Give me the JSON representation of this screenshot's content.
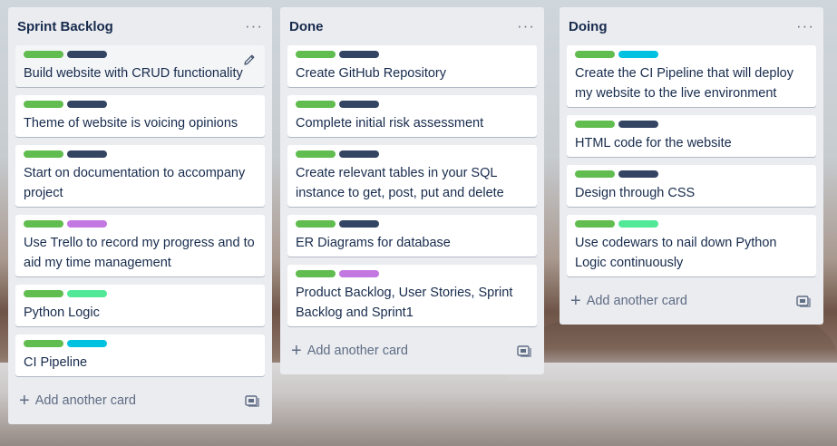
{
  "colors": {
    "green": "#61bd4f",
    "navy": "#344563",
    "purple": "#c377e0",
    "sky": "#00c2e0",
    "lime": "#51e898"
  },
  "icons": {
    "list_menu": "ellipsis-icon",
    "card_edit": "pencil-icon",
    "add": "plus-icon",
    "template": "card-template-icon"
  },
  "lists": [
    {
      "title": "Sprint Backlog",
      "menu": "···",
      "add_label": "Add another card",
      "add_icon": "+",
      "cards": [
        {
          "title": "Build website with CRUD functionality",
          "labels": [
            "green",
            "navy"
          ]
        },
        {
          "title": "Theme of website is voicing opinions",
          "labels": [
            "green",
            "navy"
          ]
        },
        {
          "title": "Start on documentation to accompany project",
          "labels": [
            "green",
            "navy"
          ]
        },
        {
          "title": "Use Trello to record my progress and to aid my time management",
          "labels": [
            "green",
            "purple"
          ]
        },
        {
          "title": "Python Logic",
          "labels": [
            "green",
            "lime"
          ]
        },
        {
          "title": "CI Pipeline",
          "labels": [
            "green",
            "sky"
          ]
        }
      ]
    },
    {
      "title": "Done",
      "menu": "···",
      "add_label": "Add another card",
      "add_icon": "+",
      "cards": [
        {
          "title": "Create GitHub Repository",
          "labels": [
            "green",
            "navy"
          ]
        },
        {
          "title": "Complete initial risk assessment",
          "labels": [
            "green",
            "navy"
          ]
        },
        {
          "title": "Create relevant tables in your SQL instance to get, post, put and delete",
          "labels": [
            "green",
            "navy"
          ]
        },
        {
          "title": "ER Diagrams for database",
          "labels": [
            "green",
            "navy"
          ]
        },
        {
          "title": "Product Backlog, User Stories, Sprint Backlog and Sprint1",
          "labels": [
            "green",
            "purple"
          ]
        }
      ]
    },
    {
      "title": "Doing",
      "menu": "···",
      "add_label": "Add another card",
      "add_icon": "+",
      "cards": [
        {
          "title": "Create the CI Pipeline that will deploy my website to the live environment",
          "labels": [
            "green",
            "sky"
          ]
        },
        {
          "title": "HTML code for the website",
          "labels": [
            "green",
            "navy"
          ]
        },
        {
          "title": "Design through CSS",
          "labels": [
            "green",
            "navy"
          ]
        },
        {
          "title": "Use codewars to nail down Python Logic continuously",
          "labels": [
            "green",
            "lime"
          ]
        }
      ]
    }
  ]
}
